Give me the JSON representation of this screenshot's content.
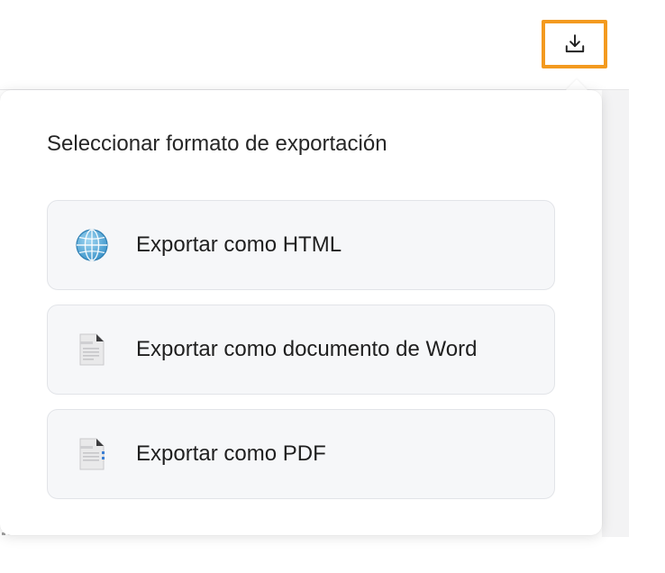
{
  "toolbar": {
    "export_icon": "download-icon",
    "highlight_color": "#f39a1f"
  },
  "export_popover": {
    "title": "Seleccionar formato de exportación",
    "options": [
      {
        "label": "Exportar como HTML",
        "icon": "globe-icon"
      },
      {
        "label": "Exportar como documento de Word",
        "icon": "word-document-icon"
      },
      {
        "label": "Exportar como PDF",
        "icon": "pdf-document-icon"
      }
    ]
  }
}
